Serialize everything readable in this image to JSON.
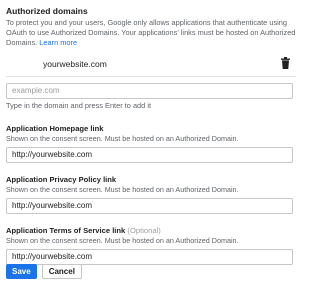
{
  "authorized_domains": {
    "heading": "Authorized domains",
    "description": "To protect you and your users, Google only allows applications that authenticate using OAuth to use Authorized Domains. Your applications' links must be hosted on Authorized Domains.",
    "learn_more": "Learn more",
    "domains": [
      "yourwebsite.com"
    ],
    "new_domain_placeholder": "example.com",
    "new_domain_hint": "Type in the domain and press Enter to add it"
  },
  "homepage_link": {
    "title": "Application Homepage link",
    "subtitle": "Shown on the consent screen. Must be hosted on an Authorized Domain.",
    "value": "http://yourwebsite.com"
  },
  "privacy_link": {
    "title": "Application Privacy Policy link",
    "subtitle": "Shown on the consent screen. Must be hosted on an Authorized Domain.",
    "value": "http://yourwebsite.com"
  },
  "terms_link": {
    "title": "Application Terms of Service link",
    "optional": "(Optional)",
    "subtitle": "Shown on the consent screen. Must be hosted on an Authorized Domain.",
    "value": "http://yourwebsite.com"
  },
  "actions": {
    "save": "Save",
    "cancel": "Cancel"
  },
  "colors": {
    "primary": "#1a73e8",
    "text": "#212121",
    "secondary_text": "#5f6368"
  }
}
